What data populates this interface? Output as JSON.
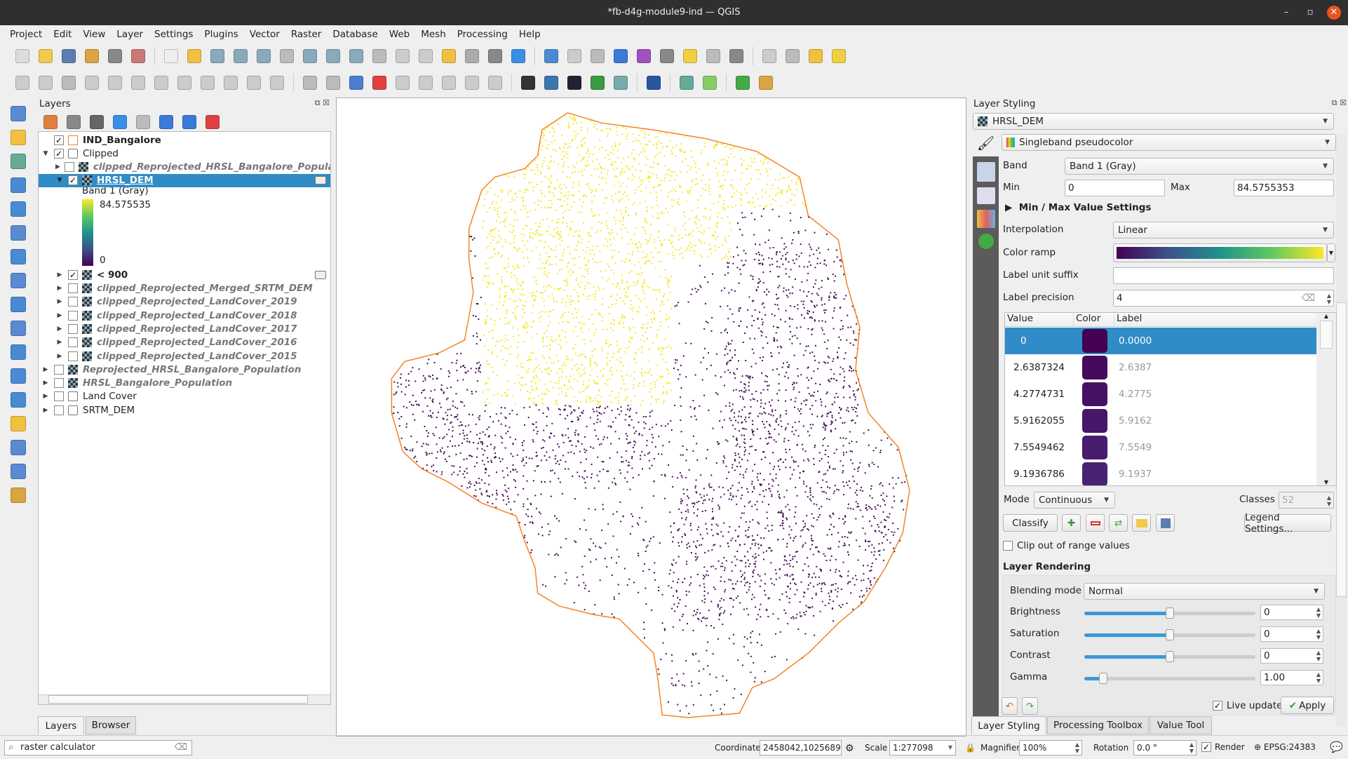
{
  "window": {
    "title": "*fb-d4g-module9-ind — QGIS",
    "minimize": "–",
    "maximize": "▫",
    "close": "✕"
  },
  "menu": [
    "Project",
    "Edit",
    "View",
    "Layer",
    "Settings",
    "Plugins",
    "Vector",
    "Raster",
    "Database",
    "Web",
    "Mesh",
    "Processing",
    "Help"
  ],
  "toolbar1": [
    [
      "new-project-icon",
      "#ddd"
    ],
    [
      "open-project-icon",
      "#f2c94c"
    ],
    [
      "save-project-icon",
      "#5b7db1"
    ],
    [
      "new-print-layout-icon",
      "#d9a441"
    ],
    [
      "layout-manager-icon",
      "#888"
    ],
    [
      "style-manager-icon",
      "#c77"
    ],
    "|",
    [
      "pan-icon",
      "#eee"
    ],
    [
      "pan-to-selection-icon",
      "#f0c040"
    ],
    [
      "zoom-in-icon",
      "#8ab"
    ],
    [
      "zoom-out-icon",
      "#8ab"
    ],
    [
      "zoom-full-icon",
      "#8ab"
    ],
    [
      "zoom-to-selection-icon",
      "#bbb"
    ],
    [
      "zoom-to-layer-icon",
      "#8ab"
    ],
    [
      "zoom-native-icon",
      "#8ab"
    ],
    [
      "zoom-last-icon",
      "#8ab"
    ],
    [
      "zoom-next-icon",
      "#bbb"
    ],
    [
      "new-map-view-icon",
      "#ccc"
    ],
    [
      "new-3d-view-icon",
      "#ccc"
    ],
    [
      "temporal-controller-icon",
      "#f0c040"
    ],
    [
      "bookmarks-icon",
      "#aaa"
    ],
    [
      "show-bookmarks-icon",
      "#888"
    ],
    [
      "refresh-icon",
      "#3a8ee6"
    ],
    "|",
    [
      "identify-icon",
      "#4a8ad4"
    ],
    [
      "attribute-table-icon",
      "#ccc"
    ],
    [
      "field-calculator-icon",
      "#bbb"
    ],
    [
      "processing-toolbox-icon",
      "#3c7ad8"
    ],
    [
      "statistics-icon",
      "#a050c0"
    ],
    [
      "measure-icon",
      "#888"
    ],
    [
      "map-tips-icon",
      "#f0d040"
    ],
    [
      "annotation-icon",
      "#bbb"
    ],
    [
      "text-annotation-icon",
      "#888"
    ],
    "|",
    [
      "select-features-icon",
      "#ccc"
    ],
    [
      "deselect-icon",
      "#bbb"
    ],
    [
      "select-by-expression-icon",
      "#f0c040"
    ],
    [
      "select-location-icon",
      "#f0d040"
    ]
  ],
  "toolbar2": [
    [
      "toggle-editing-icon",
      "#ccc"
    ],
    [
      "edit-pencil-icon",
      "#ccc"
    ],
    [
      "save-edits-icon",
      "#bbb"
    ],
    [
      "digitize-icon",
      "#ccc"
    ],
    [
      "vertex-tool-icon",
      "#ccc"
    ],
    [
      "edit-attributes-icon",
      "#ccc"
    ],
    [
      "delete-selected-icon",
      "#ccc"
    ],
    [
      "cut-icon",
      "#ccc"
    ],
    [
      "copy-icon",
      "#ccc"
    ],
    [
      "paste-icon",
      "#ccc"
    ],
    [
      "undo-icon",
      "#ccc"
    ],
    [
      "redo-icon",
      "#ccc"
    ],
    "|",
    [
      "label-tool-icon",
      "#bbb"
    ],
    [
      "label-pin-icon",
      "#bbb"
    ],
    [
      "label-highlight-icon",
      "#4a7fd0"
    ],
    [
      "label-abc-icon",
      "#e04040"
    ],
    [
      "label-move-icon",
      "#ccc"
    ],
    [
      "label-rotate-icon",
      "#ccc"
    ],
    [
      "label-change-icon",
      "#ccc"
    ],
    [
      "label-show-icon",
      "#ccc"
    ],
    [
      "label-properties-icon",
      "#ccc"
    ],
    "|",
    [
      "qgis-plugin-icon",
      "#333"
    ],
    [
      "python-console-icon",
      "#3a76b0"
    ],
    [
      "globe-icon",
      "#223"
    ],
    [
      "info-plugin-icon",
      "#3a9a40"
    ],
    [
      "georeferencer-icon",
      "#7aa"
    ],
    "|",
    [
      "help-icon",
      "#2a55a0"
    ],
    "|",
    [
      "qms-icon",
      "#6a9"
    ],
    [
      "raster-icon",
      "#8c6"
    ],
    "|",
    [
      "search-plugin-icon",
      "#4a4"
    ],
    [
      "magic-tool-icon",
      "#d9a441"
    ]
  ],
  "lefttoolbar": [
    [
      "data-source-manager-icon",
      "#5a8ad0"
    ],
    [
      "add-vector-icon",
      "#f0c040"
    ],
    [
      "add-raster-icon",
      "#6a9"
    ],
    [
      "add-delimited-icon",
      "#4a8ad4"
    ],
    [
      "add-spatialite-icon",
      "#4a8ad4"
    ],
    [
      "add-postgis-icon",
      "#5a8ad0"
    ],
    [
      "add-virtual-icon",
      "#4a8ad4"
    ],
    [
      "add-wms-icon",
      "#5a8ad0"
    ],
    [
      "add-wcs-icon",
      "#4a8ad4"
    ],
    [
      "add-wfs-icon",
      "#5a8ad0"
    ],
    [
      "new-gpkg-icon",
      "#4a8ad4"
    ],
    [
      "new-shapefile-icon",
      "#4a8ad4"
    ],
    [
      "new-spatialite-icon",
      "#4a8ad4"
    ],
    [
      "new-temp-layer-icon",
      "#f0c040"
    ],
    [
      "add-xyz-icon",
      "#5a8ad0"
    ],
    [
      "add-mesh-icon",
      "#5a8ad0"
    ],
    [
      "add-vector-tile-icon",
      "#d9a441"
    ]
  ],
  "layers": {
    "title": "Layers",
    "panel_tools": [
      [
        "style-layer-icon",
        "#e08040"
      ],
      [
        "add-group-icon",
        "#888"
      ],
      [
        "visibility-icon",
        "#666"
      ],
      [
        "filter-legend-icon",
        "#3a8ee6"
      ],
      [
        "filter-expression-icon",
        "#bbb"
      ],
      [
        "expand-all-icon",
        "#3a7ad8"
      ],
      [
        "collapse-all-icon",
        "#3a7ad8"
      ],
      [
        "remove-layer-icon",
        "#e04040"
      ]
    ],
    "rows": [
      {
        "label": "IND_Bangalore",
        "indent": 0,
        "checked": true,
        "expander": "",
        "icon": "vector",
        "style": "bold"
      },
      {
        "label": "Clipped",
        "indent": 0,
        "checked": true,
        "expander": "▼",
        "icon": "group",
        "style": ""
      },
      {
        "label": "clipped_Reprojected_HRSL_Bangalore_Popula",
        "indent": 1,
        "checked": false,
        "expander": "▶",
        "icon": "raster",
        "style": "ital"
      },
      {
        "label": "HRSL_DEM",
        "indent": 1,
        "checked": true,
        "expander": "▼",
        "icon": "raster",
        "style": "bold",
        "selected": true,
        "badge": true
      },
      {
        "label": "< 900",
        "indent": 1,
        "checked": true,
        "expander": "▶",
        "icon": "raster",
        "style": "bold",
        "badge": true
      },
      {
        "label": "clipped_Reprojected_Merged_SRTM_DEM",
        "indent": 1,
        "checked": false,
        "expander": "▶",
        "icon": "raster",
        "style": "ital"
      },
      {
        "label": "clipped_Reprojected_LandCover_2019",
        "indent": 1,
        "checked": false,
        "expander": "▶",
        "icon": "raster",
        "style": "ital"
      },
      {
        "label": "clipped_Reprojected_LandCover_2018",
        "indent": 1,
        "checked": false,
        "expander": "▶",
        "icon": "raster",
        "style": "ital"
      },
      {
        "label": "clipped_Reprojected_LandCover_2017",
        "indent": 1,
        "checked": false,
        "expander": "▶",
        "icon": "raster",
        "style": "ital"
      },
      {
        "label": "clipped_Reprojected_LandCover_2016",
        "indent": 1,
        "checked": false,
        "expander": "▶",
        "icon": "raster",
        "style": "ital"
      },
      {
        "label": "clipped_Reprojected_LandCover_2015",
        "indent": 1,
        "checked": false,
        "expander": "▶",
        "icon": "raster",
        "style": "ital"
      },
      {
        "label": "Reprojected_HRSL_Bangalore_Population",
        "indent": 0,
        "checked": false,
        "expander": "▶",
        "icon": "raster",
        "style": "ital"
      },
      {
        "label": "HRSL_Bangalore_Population",
        "indent": 0,
        "checked": false,
        "expander": "▶",
        "icon": "raster",
        "style": "ital"
      },
      {
        "label": "Land Cover",
        "indent": 0,
        "checked": false,
        "expander": "▶",
        "icon": "group",
        "style": ""
      },
      {
        "label": "SRTM_DEM",
        "indent": 0,
        "checked": false,
        "expander": "▶",
        "icon": "group",
        "style": ""
      }
    ],
    "legend": {
      "band": "Band 1 (Gray)",
      "max": "84.575535",
      "min": "0"
    },
    "tabs": [
      "Layers",
      "Browser"
    ]
  },
  "map": {
    "boundary_color": "#f58220",
    "high_color": "#f5e61a",
    "low_color": "#440154"
  },
  "styling": {
    "title": "Layer Styling",
    "layer": "HRSL_DEM",
    "renderer": "Singleband pseudocolor",
    "band_label": "Band",
    "band": "Band 1 (Gray)",
    "min_label": "Min",
    "min": "0",
    "max_label": "Max",
    "max": "84.5755353",
    "minmax_settings": "Min / Max Value Settings",
    "interp_label": "Interpolation",
    "interp": "Linear",
    "ramp_label": "Color ramp",
    "ramp_colors": [
      "#440154",
      "#3b528b",
      "#21918c",
      "#5ec962",
      "#fde725"
    ],
    "suffix_label": "Label unit suffix",
    "suffix": "",
    "precision_label": "Label precision",
    "precision": "4",
    "table_headers": [
      "Value",
      "Color",
      "Label"
    ],
    "table_rows": [
      {
        "value": "0",
        "color": "#440154",
        "label": "0.0000"
      },
      {
        "value": "2.6387324",
        "color": "#450a5c",
        "label": "2.6387"
      },
      {
        "value": "4.2774731",
        "color": "#461163",
        "label": "4.2775"
      },
      {
        "value": "5.9162055",
        "color": "#471769",
        "label": "5.9162"
      },
      {
        "value": "7.5549462",
        "color": "#481c6e",
        "label": "7.5549"
      },
      {
        "value": "9.1936786",
        "color": "#482374",
        "label": "9.1937"
      }
    ],
    "mode_label": "Mode",
    "mode": "Continuous",
    "classes_label": "Classes",
    "classes": "52",
    "classify": "Classify",
    "legend_settings": "Legend Settings...",
    "clip": "Clip out of range values",
    "rendering_title": "Layer Rendering",
    "blend_label": "Blending mode",
    "blend": "Normal",
    "sliders": [
      {
        "label": "Brightness",
        "value": "0",
        "fraction": 0.5
      },
      {
        "label": "Saturation",
        "value": "0",
        "fraction": 0.5
      },
      {
        "label": "Contrast",
        "value": "0",
        "fraction": 0.5
      },
      {
        "label": "Gamma",
        "value": "1.00",
        "fraction": 0.11
      }
    ],
    "live_update": "Live update",
    "apply": "Apply",
    "tabs": [
      "Layer Styling",
      "Processing Toolbox",
      "Value Tool"
    ]
  },
  "status": {
    "search": "raster calculator",
    "coord_label": "Coordinate",
    "coord": "2458042,1025689",
    "scale_label": "Scale",
    "scale": "1:277098",
    "magnifier_label": "Magnifier",
    "magnifier": "100%",
    "rotation_label": "Rotation",
    "rotation": "0.0 °",
    "render": "Render",
    "crs": "EPSG:24383"
  }
}
